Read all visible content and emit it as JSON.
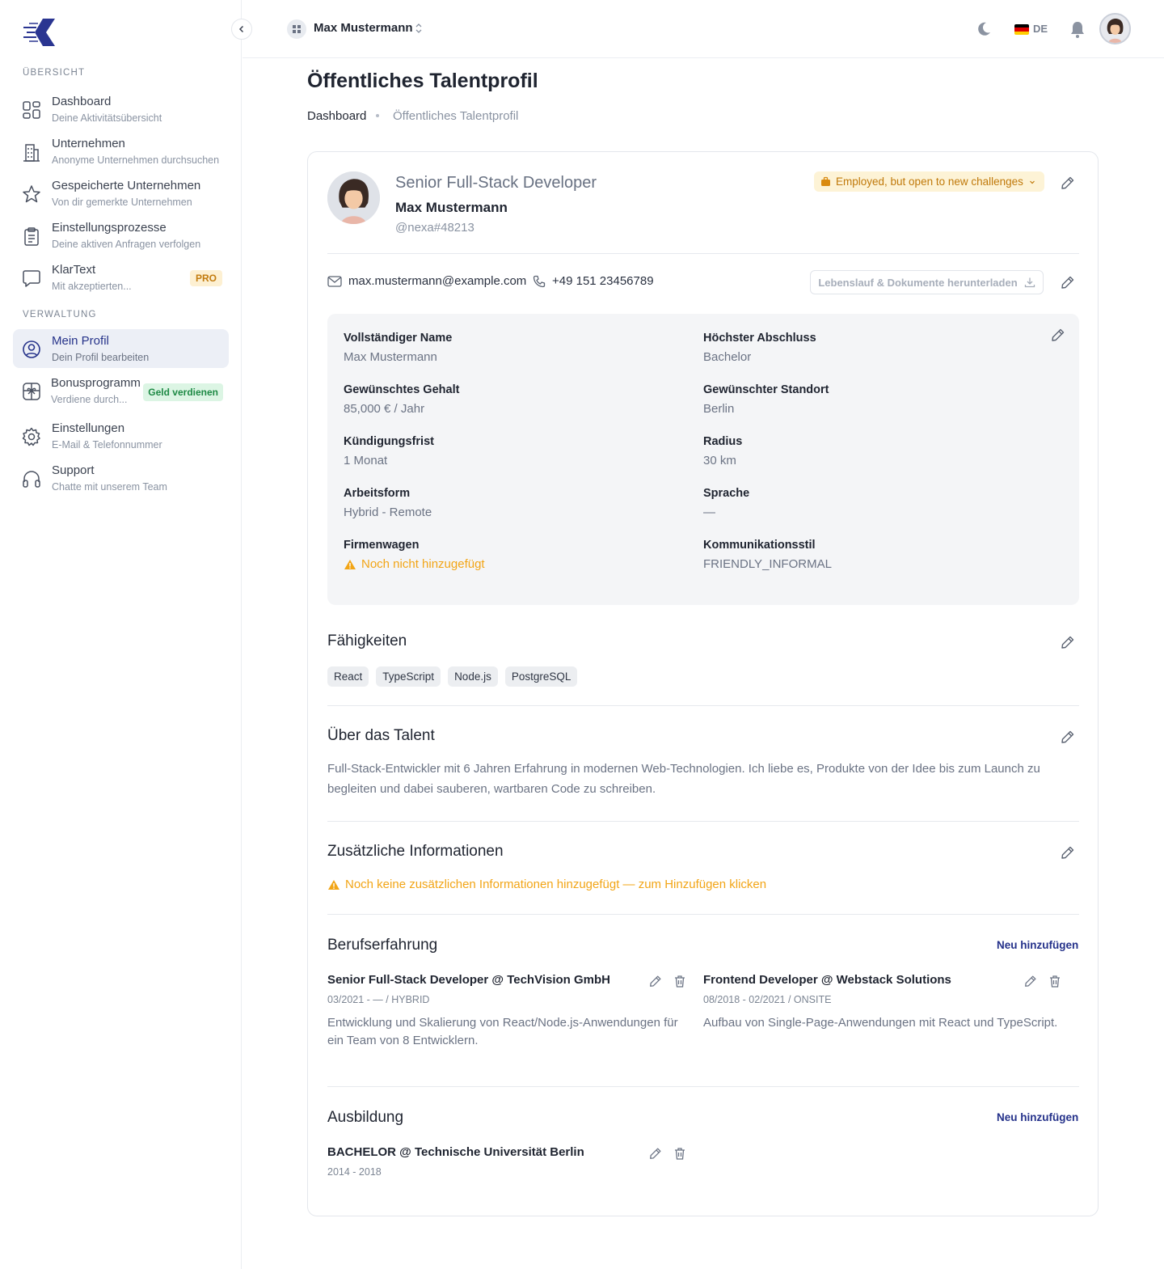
{
  "sidebar": {
    "sections": [
      {
        "label": "ÜBERSICHT"
      },
      {
        "label": "VERWALTUNG"
      }
    ],
    "items": [
      {
        "title": "Dashboard",
        "subtitle": "Deine Aktivitätsübersicht",
        "icon": "dashboard-grid-icon"
      },
      {
        "title": "Unternehmen",
        "subtitle": "Anonyme Unternehmen durchsuchen",
        "icon": "building-icon"
      },
      {
        "title": "Gespeicherte Unternehmen",
        "subtitle": "Von dir gemerkte Unternehmen",
        "icon": "star-icon"
      },
      {
        "title": "Einstellungsprozesse",
        "subtitle": "Deine aktiven Anfragen verfolgen",
        "icon": "clipboard-icon"
      },
      {
        "title": "KlarText",
        "subtitle": "Mit akzeptierten...",
        "icon": "chat-bubble-icon",
        "badge": "PRO"
      },
      {
        "title": "Mein Profil",
        "subtitle": "Dein Profil bearbeiten",
        "icon": "user-circle-icon",
        "active": true
      },
      {
        "title": "Bonusprogramm",
        "subtitle": "Verdiene durch...",
        "icon": "gift-icon",
        "badge": "Geld verdienen"
      },
      {
        "title": "Einstellungen",
        "subtitle": "E-Mail & Telefonnummer",
        "icon": "gear-icon"
      },
      {
        "title": "Support",
        "subtitle": "Chatte mit unserem Team",
        "icon": "headset-icon"
      }
    ]
  },
  "topbar": {
    "workspace_name": "Max Mustermann",
    "language": "DE"
  },
  "page": {
    "title": "Öffentliches Talentprofil",
    "breadcrumb": [
      "Dashboard",
      "Öffentliches Talentprofil"
    ]
  },
  "profile": {
    "role": "Senior Full-Stack Developer",
    "name": "Max Mustermann",
    "handle": "@nexa#48213",
    "status": "Employed, but open to new challenges",
    "email": "max.mustermann@example.com",
    "phone": "+49 151 23456789",
    "download_label": "Lebenslauf & Dokumente herunterladen"
  },
  "details": {
    "full_name": {
      "label": "Vollständiger Name",
      "value": "Max Mustermann"
    },
    "degree": {
      "label": "Höchster Abschluss",
      "value": "Bachelor"
    },
    "salary": {
      "label": "Gewünschtes Gehalt",
      "value": "85,000 € / Jahr"
    },
    "location": {
      "label": "Gewünschter Standort",
      "value": "Berlin"
    },
    "notice": {
      "label": "Kündigungsfrist",
      "value": "1 Monat"
    },
    "radius": {
      "label": "Radius",
      "value": "30 km"
    },
    "work_mode": {
      "label": "Arbeitsform",
      "value": "Hybrid - Remote"
    },
    "language": {
      "label": "Sprache",
      "value": "—"
    },
    "company_car": {
      "label": "Firmenwagen",
      "value": "Noch nicht hinzugefügt"
    },
    "comm_style": {
      "label": "Kommunikationsstil",
      "value": "FRIENDLY_INFORMAL"
    }
  },
  "skills": {
    "title": "Fähigkeiten",
    "items": [
      "React",
      "TypeScript",
      "Node.js",
      "PostgreSQL"
    ]
  },
  "about": {
    "title": "Über das Talent",
    "text": "Full-Stack-Entwickler mit 6 Jahren Erfahrung in modernen Web-Technologien. Ich liebe es, Produkte von der Idee bis zum Launch zu begleiten und dabei sauberen, wartbaren Code zu schreiben."
  },
  "additional": {
    "title": "Zusätzliche Informationen",
    "empty_text": "Noch keine zusätzlichen Informationen hinzugefügt — zum Hinzufügen klicken"
  },
  "experience": {
    "title": "Berufserfahrung",
    "add_label": "Neu hinzufügen",
    "items": [
      {
        "title": "Senior Full-Stack Developer @ TechVision GmbH",
        "meta": "03/2021 - — / HYBRID",
        "desc": "Entwicklung und Skalierung von React/Node.js-Anwendungen für ein Team von 8 Entwicklern."
      },
      {
        "title": "Frontend Developer @ Webstack Solutions",
        "meta": "08/2018 - 02/2021 / ONSITE",
        "desc": "Aufbau von Single-Page-Anwendungen mit React und TypeScript."
      }
    ]
  },
  "education": {
    "title": "Ausbildung",
    "add_label": "Neu hinzufügen",
    "items": [
      {
        "title": "BACHELOR @ Technische Universität Berlin",
        "meta": "2014 - 2018"
      }
    ]
  },
  "colors": {
    "accent": "#24318a",
    "warning": "#f2a516",
    "pro_badge": "#c27b0e",
    "money_badge": "#1e8a45"
  }
}
